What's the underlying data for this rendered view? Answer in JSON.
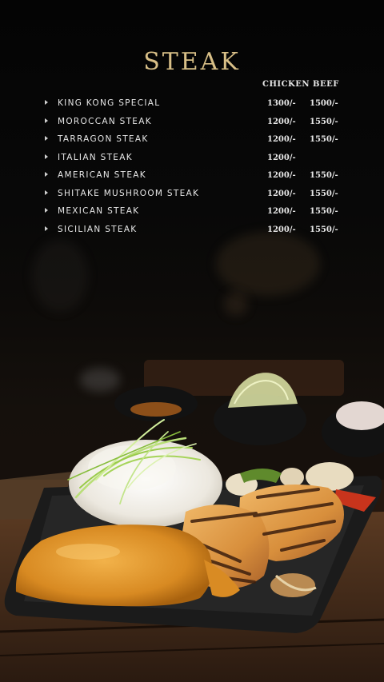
{
  "menu": {
    "title": "STEAK",
    "columns": {
      "chicken": "CHICKEN",
      "beef": "BEEF"
    },
    "items": [
      {
        "name": "KING KONG SPECIAL",
        "chicken": "1300/-",
        "beef": "1500/-"
      },
      {
        "name": "MOROCCAN STEAK",
        "chicken": "1200/-",
        "beef": "1550/-"
      },
      {
        "name": "TARRAGON STEAK",
        "chicken": "1200/-",
        "beef": "1550/-"
      },
      {
        "name": "ITALIAN STEAK",
        "chicken": "1200/-",
        "beef": ""
      },
      {
        "name": "AMERICAN STEAK",
        "chicken": "1200/-",
        "beef": "1550/-"
      },
      {
        "name": "SHITAKE MUSHROOM STEAK",
        "chicken": "1200/-",
        "beef": "1550/-"
      },
      {
        "name": "MEXICAN STEAK",
        "chicken": "1200/-",
        "beef": "1550/-"
      },
      {
        "name": "SICILIAN STEAK",
        "chicken": "1200/-",
        "beef": "1550/-"
      }
    ]
  },
  "colors": {
    "title_gold": "#d8bf87",
    "text": "#e6e6e6",
    "background": "#050505"
  }
}
